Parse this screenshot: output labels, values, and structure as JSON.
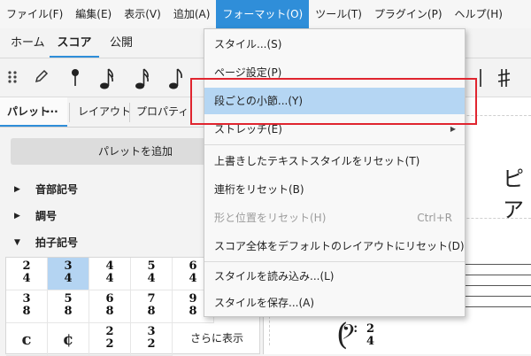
{
  "menubar": {
    "items": [
      "ファイル(F)",
      "編集(E)",
      "表示(V)",
      "追加(A)",
      "フォーマット(O)",
      "ツール(T)",
      "プラグイン(P)",
      "ヘルプ(H)"
    ],
    "active_index": 4
  },
  "topbar": {
    "tabs": [
      "ホーム",
      "スコア",
      "公開"
    ],
    "selected": "スコア"
  },
  "toolbar": {
    "icons": [
      "drag-handle-icon",
      "pencil-icon",
      "note-input-icon",
      "sixteenth-note-icon",
      "sixteenth-note-icon",
      "eighth-note-icon",
      "sharp-icon"
    ]
  },
  "panel": {
    "tabs": {
      "palette": "パレット",
      "palette_menu": "···",
      "layout": "レイアウト",
      "properties": "プロパティ"
    },
    "add_palette": "パレットを追加",
    "sections": [
      "音部記号",
      "調号",
      "拍子記号"
    ],
    "time_signatures": {
      "row1": [
        [
          "2",
          "4"
        ],
        [
          "3",
          "4"
        ],
        [
          "4",
          "4"
        ],
        [
          "5",
          "4"
        ],
        [
          "6",
          "4"
        ]
      ],
      "row2": [
        [
          "3",
          "8"
        ],
        [
          "5",
          "8"
        ],
        [
          "6",
          "8"
        ],
        [
          "7",
          "8"
        ],
        [
          "9",
          "8"
        ]
      ],
      "row3": [
        [
          "c"
        ],
        [
          "¢"
        ],
        [
          "2",
          "2"
        ],
        [
          "3",
          "2"
        ]
      ],
      "selected_index": 1,
      "more": "さらに表示"
    }
  },
  "score": {
    "title_fragment": "ピア",
    "clef": "𝄢",
    "time_sig": [
      "2",
      "4"
    ]
  },
  "format_menu": {
    "items": [
      {
        "label": "スタイル...(S)",
        "shortcut": "",
        "disabled": false,
        "highlighted": false,
        "submenu": false
      },
      {
        "label": "ページ設定(P)",
        "shortcut": "",
        "disabled": false,
        "highlighted": false,
        "submenu": false
      },
      {
        "label": "段ごとの小節...(Y)",
        "shortcut": "",
        "disabled": false,
        "highlighted": true,
        "submenu": false
      },
      {
        "label": "ストレッチ(E)",
        "shortcut": "",
        "disabled": false,
        "highlighted": false,
        "submenu": true
      },
      {
        "label": "上書きしたテキストスタイルをリセット(T)",
        "shortcut": "",
        "disabled": false,
        "highlighted": false,
        "submenu": false
      },
      {
        "label": "連桁をリセット(B)",
        "shortcut": "",
        "disabled": false,
        "highlighted": false,
        "submenu": false
      },
      {
        "label": "形と位置をリセット(H)",
        "shortcut": "Ctrl+R",
        "disabled": true,
        "highlighted": false,
        "submenu": false
      },
      {
        "label": "スコア全体をデフォルトのレイアウトにリセット(D)",
        "shortcut": "",
        "disabled": false,
        "highlighted": false,
        "submenu": false
      },
      {
        "label": "スタイルを読み込み...(L)",
        "shortcut": "",
        "disabled": false,
        "highlighted": false,
        "submenu": false
      },
      {
        "label": "スタイルを保存...(A)",
        "shortcut": "",
        "disabled": false,
        "highlighted": false,
        "submenu": false
      }
    ]
  },
  "colors": {
    "accent": "#2f8ed9",
    "highlight": "#b5d6f3",
    "annotation": "#e0252f"
  }
}
